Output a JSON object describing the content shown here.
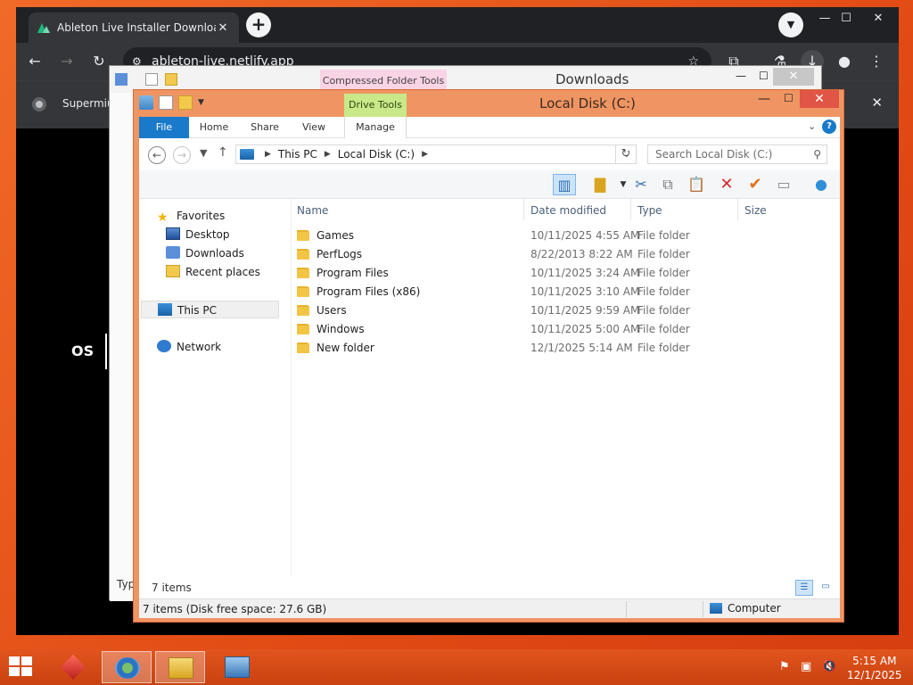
{
  "browser": {
    "tab_title": "Ableton Live Installer Download",
    "url": "ableton-live.netlify.app",
    "bookmark_text": "Supermiu",
    "page_label": "OS"
  },
  "back_window": {
    "context_tab": "Compressed Folder Tools",
    "title": "Downloads",
    "status_partial": "Typ"
  },
  "explorer": {
    "context_tab": "Drive Tools",
    "title": "Local Disk (C:)",
    "ribbon_tabs": [
      "File",
      "Home",
      "Share",
      "View",
      "Manage"
    ],
    "breadcrumb": [
      "This PC",
      "Local Disk (C:)"
    ],
    "search_placeholder": "Search Local Disk (C:)",
    "nav": {
      "favorites": "Favorites",
      "desktop": "Desktop",
      "downloads": "Downloads",
      "recent": "Recent places",
      "this_pc": "This PC",
      "network": "Network"
    },
    "columns": {
      "name": "Name",
      "date": "Date modified",
      "type": "Type",
      "size": "Size"
    },
    "files": [
      {
        "name": "Games",
        "date": "10/11/2025 4:55 AM",
        "type": "File folder"
      },
      {
        "name": "PerfLogs",
        "date": "8/22/2013 8:22 AM",
        "type": "File folder"
      },
      {
        "name": "Program Files",
        "date": "10/11/2025 3:24 AM",
        "type": "File folder"
      },
      {
        "name": "Program Files (x86)",
        "date": "10/11/2025 3:10 AM",
        "type": "File folder"
      },
      {
        "name": "Users",
        "date": "10/11/2025 9:59 AM",
        "type": "File folder"
      },
      {
        "name": "Windows",
        "date": "10/11/2025 5:00 AM",
        "type": "File folder"
      },
      {
        "name": "New folder",
        "date": "12/1/2025 5:14 AM",
        "type": "File folder"
      }
    ],
    "item_count": "7 items",
    "status_text": "7 items (Disk free space: 27.6 GB)",
    "status_location": "Computer"
  },
  "taskbar": {
    "time": "5:15 AM",
    "date": "12/1/2025"
  },
  "colors": {
    "desktop": "#e8501c",
    "window_frame": "#ef9563",
    "file_tab": "#1979ca",
    "drive_tools": "#c8e88a",
    "compressed_tools": "#f9d3e6"
  }
}
